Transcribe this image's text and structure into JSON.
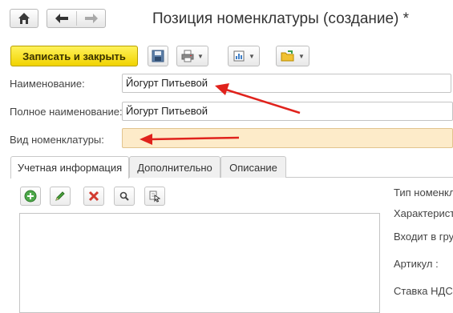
{
  "window": {
    "title": "Позиция номенклатуры (создание) *"
  },
  "toolbar": {
    "save_close_label": "Записать и закрыть",
    "icons": [
      "save-icon",
      "print-icon",
      "report-icon",
      "folder-icon"
    ]
  },
  "form": {
    "name_label": "Наименование:",
    "name_value": "Йогурт Питьевой",
    "full_name_label": "Полное наименование:",
    "full_name_value": "Йогурт Питьевой",
    "type_label": "Вид номенклатуры:",
    "type_value": ""
  },
  "tabs": [
    {
      "label": "Учетная информация",
      "active": true
    },
    {
      "label": "Дополнительно",
      "active": false
    },
    {
      "label": "Описание",
      "active": false
    }
  ],
  "right_panel": {
    "type_label": "Тип номенкл",
    "characteristics_label": "Характеристи",
    "group_label": "Входит в гру",
    "article_label": "Артикул :",
    "vat_label": "Ставка НДС"
  },
  "colors": {
    "accent_button": "#f5dc1a",
    "required_field_bg": "#fdebc9",
    "annotation_arrow": "#e0221c"
  }
}
